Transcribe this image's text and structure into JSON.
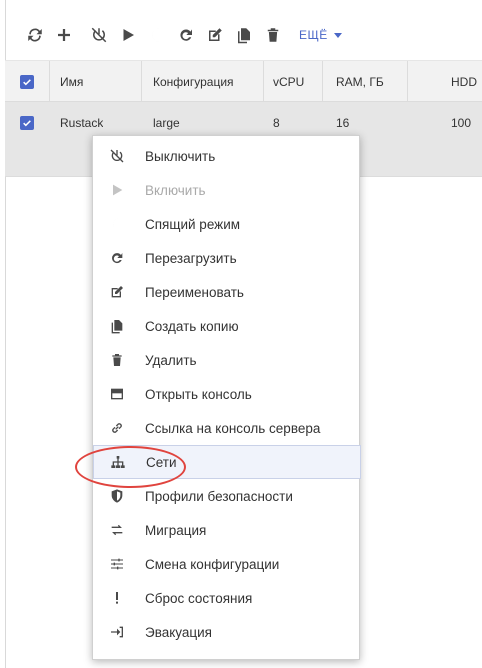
{
  "toolbar": {
    "icons": [
      "refresh-icon",
      "add-icon",
      "power-off-icon",
      "play-icon",
      "moon-icon",
      "restart-icon",
      "edit-icon",
      "copy-icon",
      "trash-icon"
    ],
    "more_label": "ЕЩЁ",
    "accent": "#4a67c7"
  },
  "table": {
    "headers": [
      "Имя",
      "Конфигурация",
      "vCPU",
      "RAM, ГБ",
      "HDD"
    ],
    "rows": [
      {
        "name": "Rustack",
        "config": "large",
        "vcpu": "8",
        "ram": "16",
        "hdd": "100"
      }
    ]
  },
  "menu": {
    "items": [
      {
        "label": "Выключить",
        "icon": "power-off-icon"
      },
      {
        "label": "Включить",
        "icon": "play-icon",
        "disabled": true
      },
      {
        "label": "Спящий режим",
        "icon": "moon-icon"
      },
      {
        "label": "Перезагрузить",
        "icon": "restart-icon"
      },
      {
        "label": "Переименовать",
        "icon": "edit-icon"
      },
      {
        "label": "Создать копию",
        "icon": "copy-icon"
      },
      {
        "label": "Удалить",
        "icon": "trash-icon"
      },
      {
        "label": "Открыть консоль",
        "icon": "console-icon"
      },
      {
        "label": "Ссылка на консоль сервера",
        "icon": "link-icon"
      },
      {
        "label": "Сети",
        "icon": "network-icon",
        "highlighted": true
      },
      {
        "label": "Профили безопасности",
        "icon": "shield-icon"
      },
      {
        "label": "Миграция",
        "icon": "migration-icon"
      },
      {
        "label": "Смена конфигурации",
        "icon": "sliders-icon"
      },
      {
        "label": "Сброс состояния",
        "icon": "exclamation-icon"
      },
      {
        "label": "Эвакуация",
        "icon": "evacuate-icon"
      }
    ],
    "highlight_color": "#e0443e"
  }
}
